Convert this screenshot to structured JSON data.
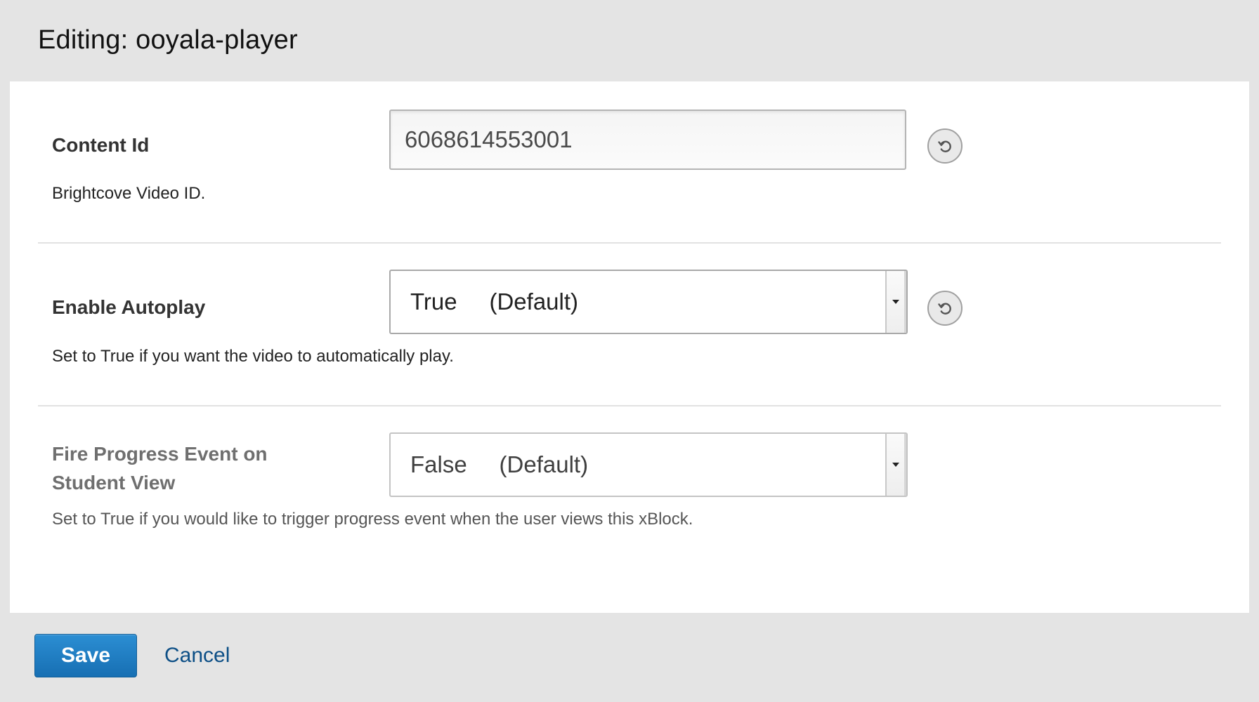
{
  "header": {
    "title": "Editing: ooyala-player"
  },
  "fields": {
    "content_id": {
      "label": "Content Id",
      "value": "6068614553001",
      "help": "Brightcove Video ID.",
      "reset_icon": "reset-icon"
    },
    "enable_autoplay": {
      "label": "Enable Autoplay",
      "selected": "True     (Default)",
      "help": "Set to True if you want the video to automatically play.",
      "reset_icon": "reset-icon"
    },
    "fire_progress_event": {
      "label": "Fire Progress Event on Student View",
      "selected": "False     (Default)",
      "help": "Set to True if you would like to trigger progress event when the user views this xBlock."
    }
  },
  "footer": {
    "save_label": "Save",
    "cancel_label": "Cancel"
  },
  "colors": {
    "save_button": "#1f7fc4",
    "cancel_link": "#0d4f86",
    "chrome_background": "#e4e4e4"
  }
}
